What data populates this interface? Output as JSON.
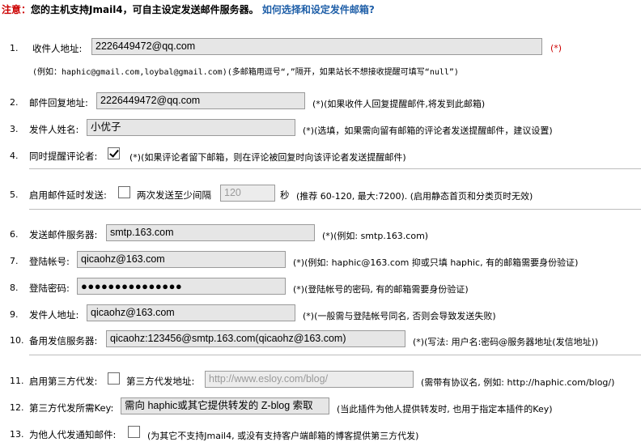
{
  "header": {
    "prefix": "注意：",
    "text": "您的主机支持Jmail4，可自主设定发送邮件服务器。",
    "link": "如何选择和设定发件邮箱?"
  },
  "rows": [
    {
      "num": "1.",
      "label": "收件人地址:",
      "value": "2226449472@qq.com",
      "note": "(*)"
    },
    {
      "example": "(例如：haphic@gmail.com,loybal@gmail.com)(多邮箱用逗号“,”隔开，如果站长不想接收提醒可填写“null”)"
    },
    {
      "num": "2.",
      "label": "邮件回复地址:",
      "value": "2226449472@qq.com",
      "note": "(*)(如果收件人回复提醒邮件,将发到此邮箱)"
    },
    {
      "num": "3.",
      "label": "发件人姓名:",
      "value": "小优子",
      "note": "(*)(选填，如果需向留有邮箱的评论者发送提醒邮件，建议设置)"
    },
    {
      "num": "4.",
      "label": "同时提醒评论者:",
      "note": "(*)(如果评论者留下邮箱，则在评论被回复时向该评论者发送提醒邮件)"
    },
    {
      "num": "5.",
      "label": "启用邮件延时发送:",
      "label2": "两次发送至少间隔",
      "value": "120",
      "unit": "秒",
      "note": "(推荐 60-120, 最大:7200). (启用静态首页和分类页时无效)"
    },
    {
      "num": "6.",
      "label": "发送邮件服务器:",
      "value": "smtp.163.com",
      "note": "(*)(例如: smtp.163.com)"
    },
    {
      "num": "7.",
      "label": "登陆帐号:",
      "value": "qicaohz@163.com",
      "note": "(*)(例如: haphic@163.com 抑或只填 haphic, 有的邮箱需要身份验证)"
    },
    {
      "num": "8.",
      "label": "登陆密码:",
      "value": "●●●●●●●●●●●●●●●",
      "note": "(*)(登陆帐号的密码, 有的邮箱需要身份验证)"
    },
    {
      "num": "9.",
      "label": "发件人地址:",
      "value": "qicaohz@163.com",
      "note": "(*)(一般需与登陆帐号同名, 否则会导致发送失败)"
    },
    {
      "num": "10.",
      "label": "备用发信服务器:",
      "value": "qicaohz:123456@smtp.163.com(qicaohz@163.com)",
      "note": "(*)(写法: 用户名:密码@服务器地址(发信地址))"
    },
    {
      "num": "11.",
      "label": "启用第三方代发:",
      "label2": "第三方代发地址:",
      "placeholder": "http://www.esloy.com/blog/",
      "note": "(需带有协议名, 例如: http://haphic.com/blog/)"
    },
    {
      "num": "12.",
      "label": "第三方代发所需Key:",
      "value": "需向 haphic或其它提供转发的 Z-blog 索取",
      "note": "(当此插件为他人提供转发时, 也用于指定本插件的Key)"
    },
    {
      "num": "13.",
      "label": "为他人代发通知邮件:",
      "note": "(为其它不支持Jmail4, 或没有支持客户端邮箱的博客提供第三方代发)"
    }
  ]
}
